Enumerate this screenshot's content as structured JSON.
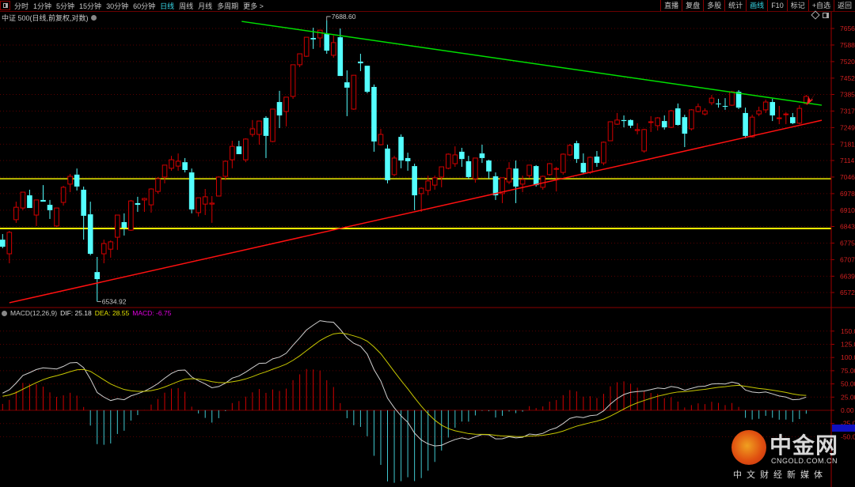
{
  "toolbar": {
    "tabs": [
      "分时",
      "1分钟",
      "5分钟",
      "15分钟",
      "30分钟",
      "60分钟",
      "日线",
      "周线",
      "月线",
      "多周期",
      "更多 >"
    ],
    "active_tab": "日线",
    "right_buttons": [
      "直播",
      "复盘",
      "多股",
      "统计",
      "画线",
      "F10",
      "标记",
      "+自选",
      "返回"
    ],
    "active_right": "画线"
  },
  "subtitle": "中证 500(日线,前复权,对数)",
  "macd_legend": {
    "name": "MACD(12,26,9)",
    "dif": "DIF: 25.18",
    "dea": "DEA: 28.55",
    "macd": "MACD: -6.75"
  },
  "annotations": {
    "high": "7688.60",
    "low": "6534.92"
  },
  "watermark": {
    "name": "中金网",
    "url": "CNGOLD.COM.CN",
    "tagline": "中文财经新媒体"
  },
  "colors": {
    "up": "#d40000",
    "down": "#54ffff",
    "resistance": "#00e000",
    "support": "#ff1010",
    "level1": "#b8b800",
    "level2": "#ffff00",
    "dif": "#d0d0d0",
    "dea": "#c8c800",
    "axis": "#d02020"
  },
  "chart_data": {
    "type": "candlestick",
    "title": "中证 500(日线,前复权,对数)",
    "y_ticks": [
      "7656",
      "7588",
      "7520",
      "7452",
      "7385",
      "7317",
      "7249",
      "7181",
      "7114",
      "7046",
      "6978",
      "6910",
      "6843",
      "6775",
      "6707",
      "6639",
      "6572"
    ],
    "ylim": [
      6500,
      7700
    ],
    "candles_ohlc": [
      [
        6789,
        6812,
        6754,
        6760
      ],
      [
        6731,
        6825,
        6692,
        6819
      ],
      [
        6871,
        6945,
        6858,
        6922
      ],
      [
        6919,
        6984,
        6910,
        6984
      ],
      [
        6971,
        6994,
        6919,
        6919
      ],
      [
        6890,
        6952,
        6845,
        6952
      ],
      [
        6952,
        7013,
        6945,
        6945
      ],
      [
        6932,
        6952,
        6874,
        6910
      ],
      [
        6845,
        6919,
        6841,
        6919
      ],
      [
        6942,
        7010,
        6929,
        7004
      ],
      [
        7017,
        7059,
        6984,
        7049
      ],
      [
        7056,
        7081,
        6991,
        7007
      ],
      [
        6994,
        7007,
        6789,
        6887
      ],
      [
        6893,
        6945,
        6725,
        6731
      ],
      [
        6656,
        6718,
        6534.92,
        6627
      ],
      [
        6731,
        6789,
        6692,
        6773
      ],
      [
        6750,
        6786,
        6715,
        6780
      ],
      [
        6799,
        6890,
        6747,
        6890
      ],
      [
        6861,
        6897,
        6806,
        6838
      ],
      [
        6828,
        6952,
        6825,
        6948
      ],
      [
        6939,
        6965,
        6903,
        6932
      ],
      [
        6952,
        6961,
        6903,
        6958
      ],
      [
        6932,
        7000,
        6900,
        6997
      ],
      [
        6987,
        7046,
        6978,
        7039
      ],
      [
        7046,
        7095,
        7020,
        7095
      ],
      [
        7082,
        7133,
        7072,
        7117
      ],
      [
        7091,
        7143,
        7072,
        7111
      ],
      [
        7107,
        7124,
        7065,
        7075
      ],
      [
        7065,
        7081,
        6897,
        6913
      ],
      [
        6900,
        6961,
        6884,
        6961
      ],
      [
        6935,
        6997,
        6890,
        6965
      ],
      [
        6935,
        6968,
        6858,
        6939
      ],
      [
        6968,
        7049,
        6968,
        7046
      ],
      [
        7049,
        7114,
        7033,
        7111
      ],
      [
        7117,
        7195,
        7082,
        7172
      ],
      [
        7172,
        7195,
        7140,
        7140
      ],
      [
        7117,
        7205,
        7107,
        7202
      ],
      [
        7221,
        7280,
        7211,
        7244
      ],
      [
        7221,
        7276,
        7179,
        7276
      ],
      [
        7289,
        7296,
        7124,
        7215
      ],
      [
        7192,
        7325,
        7189,
        7325
      ],
      [
        7354,
        7400,
        7247,
        7299
      ],
      [
        7315,
        7374,
        7254,
        7374
      ],
      [
        7377,
        7507,
        7367,
        7507
      ],
      [
        7507,
        7552,
        7497,
        7552
      ],
      [
        7542,
        7620,
        7539,
        7620
      ],
      [
        7617,
        7659,
        7572,
        7611
      ],
      [
        7617,
        7649,
        7578,
        7649
      ],
      [
        7633,
        7688.6,
        7552,
        7565
      ],
      [
        7546,
        7627,
        7536,
        7598
      ],
      [
        7620,
        7656,
        7461,
        7461
      ],
      [
        7435,
        7484,
        7296,
        7413
      ],
      [
        7325,
        7464,
        7322,
        7464
      ],
      [
        7520,
        7552,
        7481,
        7513
      ],
      [
        7503,
        7503,
        7390,
        7396
      ],
      [
        7416,
        7426,
        7150,
        7192
      ],
      [
        7179,
        7244,
        7176,
        7221
      ],
      [
        7163,
        7179,
        7020,
        7033
      ],
      [
        7056,
        7133,
        7049,
        7124
      ],
      [
        7211,
        7221,
        7082,
        7114
      ],
      [
        7124,
        7146,
        7072,
        7111
      ],
      [
        7091,
        7101,
        6910,
        6971
      ],
      [
        6978,
        7004,
        6903,
        7000
      ],
      [
        6991,
        7052,
        6971,
        7030
      ],
      [
        7013,
        7052,
        6994,
        7043
      ],
      [
        7046,
        7088,
        7004,
        7088
      ],
      [
        7082,
        7143,
        7078,
        7140
      ],
      [
        7101,
        7172,
        7088,
        7137
      ],
      [
        7150,
        7166,
        7088,
        7120
      ],
      [
        7111,
        7133,
        7039,
        7046
      ],
      [
        7039,
        7124,
        7023,
        7124
      ],
      [
        7143,
        7179,
        7104,
        7124
      ],
      [
        7114,
        7117,
        7039,
        7069
      ],
      [
        7049,
        7065,
        6952,
        6971
      ],
      [
        6978,
        7043,
        6939,
        7043
      ],
      [
        7026,
        7107,
        7017,
        7081
      ],
      [
        7081,
        7114,
        6939,
        7007
      ],
      [
        7017,
        7052,
        6984,
        7036
      ],
      [
        7052,
        7095,
        7043,
        7095
      ],
      [
        7091,
        7095,
        7007,
        7013
      ],
      [
        7004,
        7052,
        6994,
        7049
      ],
      [
        7056,
        7104,
        7052,
        7101
      ],
      [
        7078,
        7088,
        6987,
        7081
      ],
      [
        7065,
        7143,
        7056,
        7140
      ],
      [
        7137,
        7182,
        7133,
        7176
      ],
      [
        7185,
        7195,
        7104,
        7120
      ],
      [
        7104,
        7143,
        7059,
        7065
      ],
      [
        7065,
        7130,
        7059,
        7127
      ],
      [
        7130,
        7153,
        7088,
        7104
      ],
      [
        7104,
        7192,
        7095,
        7189
      ],
      [
        7195,
        7273,
        7195,
        7273
      ],
      [
        7263,
        7309,
        7260,
        7280
      ],
      [
        7280,
        7299,
        7250,
        7276
      ],
      [
        7280,
        7283,
        7247,
        7257
      ],
      [
        7237,
        7267,
        7221,
        7241
      ],
      [
        7153,
        7244,
        7146,
        7241
      ],
      [
        7270,
        7296,
        7231,
        7273
      ],
      [
        7257,
        7292,
        7237,
        7289
      ],
      [
        7276,
        7299,
        7241,
        7250
      ],
      [
        7250,
        7322,
        7247,
        7318
      ],
      [
        7328,
        7348,
        7257,
        7260
      ],
      [
        7292,
        7302,
        7169,
        7224
      ],
      [
        7244,
        7325,
        7237,
        7322
      ],
      [
        7315,
        7348,
        7312,
        7335
      ],
      [
        7305,
        7328,
        7299,
        7318
      ],
      [
        7351,
        7383,
        7341,
        7370
      ],
      [
        7348,
        7367,
        7331,
        7345
      ],
      [
        7338,
        7370,
        7322,
        7335
      ],
      [
        7341,
        7400,
        7338,
        7396
      ],
      [
        7396,
        7403,
        7325,
        7331
      ],
      [
        7309,
        7331,
        7205,
        7215
      ],
      [
        7211,
        7302,
        7208,
        7292
      ],
      [
        7305,
        7335,
        7296,
        7318
      ],
      [
        7322,
        7364,
        7309,
        7354
      ],
      [
        7354,
        7367,
        7276,
        7299
      ],
      [
        7287,
        7338,
        7263,
        7289
      ],
      [
        7302,
        7312,
        7263,
        7305
      ],
      [
        7292,
        7309,
        7263,
        7267
      ],
      [
        7267,
        7341,
        7263,
        7328
      ],
      [
        7348,
        7383,
        7344,
        7377
      ]
    ],
    "horizontal_levels": [
      7039,
      6835
    ],
    "trendlines": {
      "resistance": {
        "from": [
          35.4,
          7685
        ],
        "to": [
          121.3,
          7341
        ]
      },
      "support": {
        "from": [
          1.0,
          6530
        ],
        "to": [
          121.3,
          7279
        ]
      }
    },
    "high_marker": {
      "index": 48,
      "value": 7688.6
    },
    "low_marker": {
      "index": 14,
      "value": 6534.92
    },
    "macd": {
      "params": [
        12,
        26,
        9
      ],
      "y_ticks": [
        "150.00",
        "125.00",
        "100.00",
        "75.00",
        "50.00",
        "25.00",
        "0.00",
        "-25.00",
        "-50.00"
      ],
      "ylim": [
        -150,
        170
      ]
    }
  }
}
